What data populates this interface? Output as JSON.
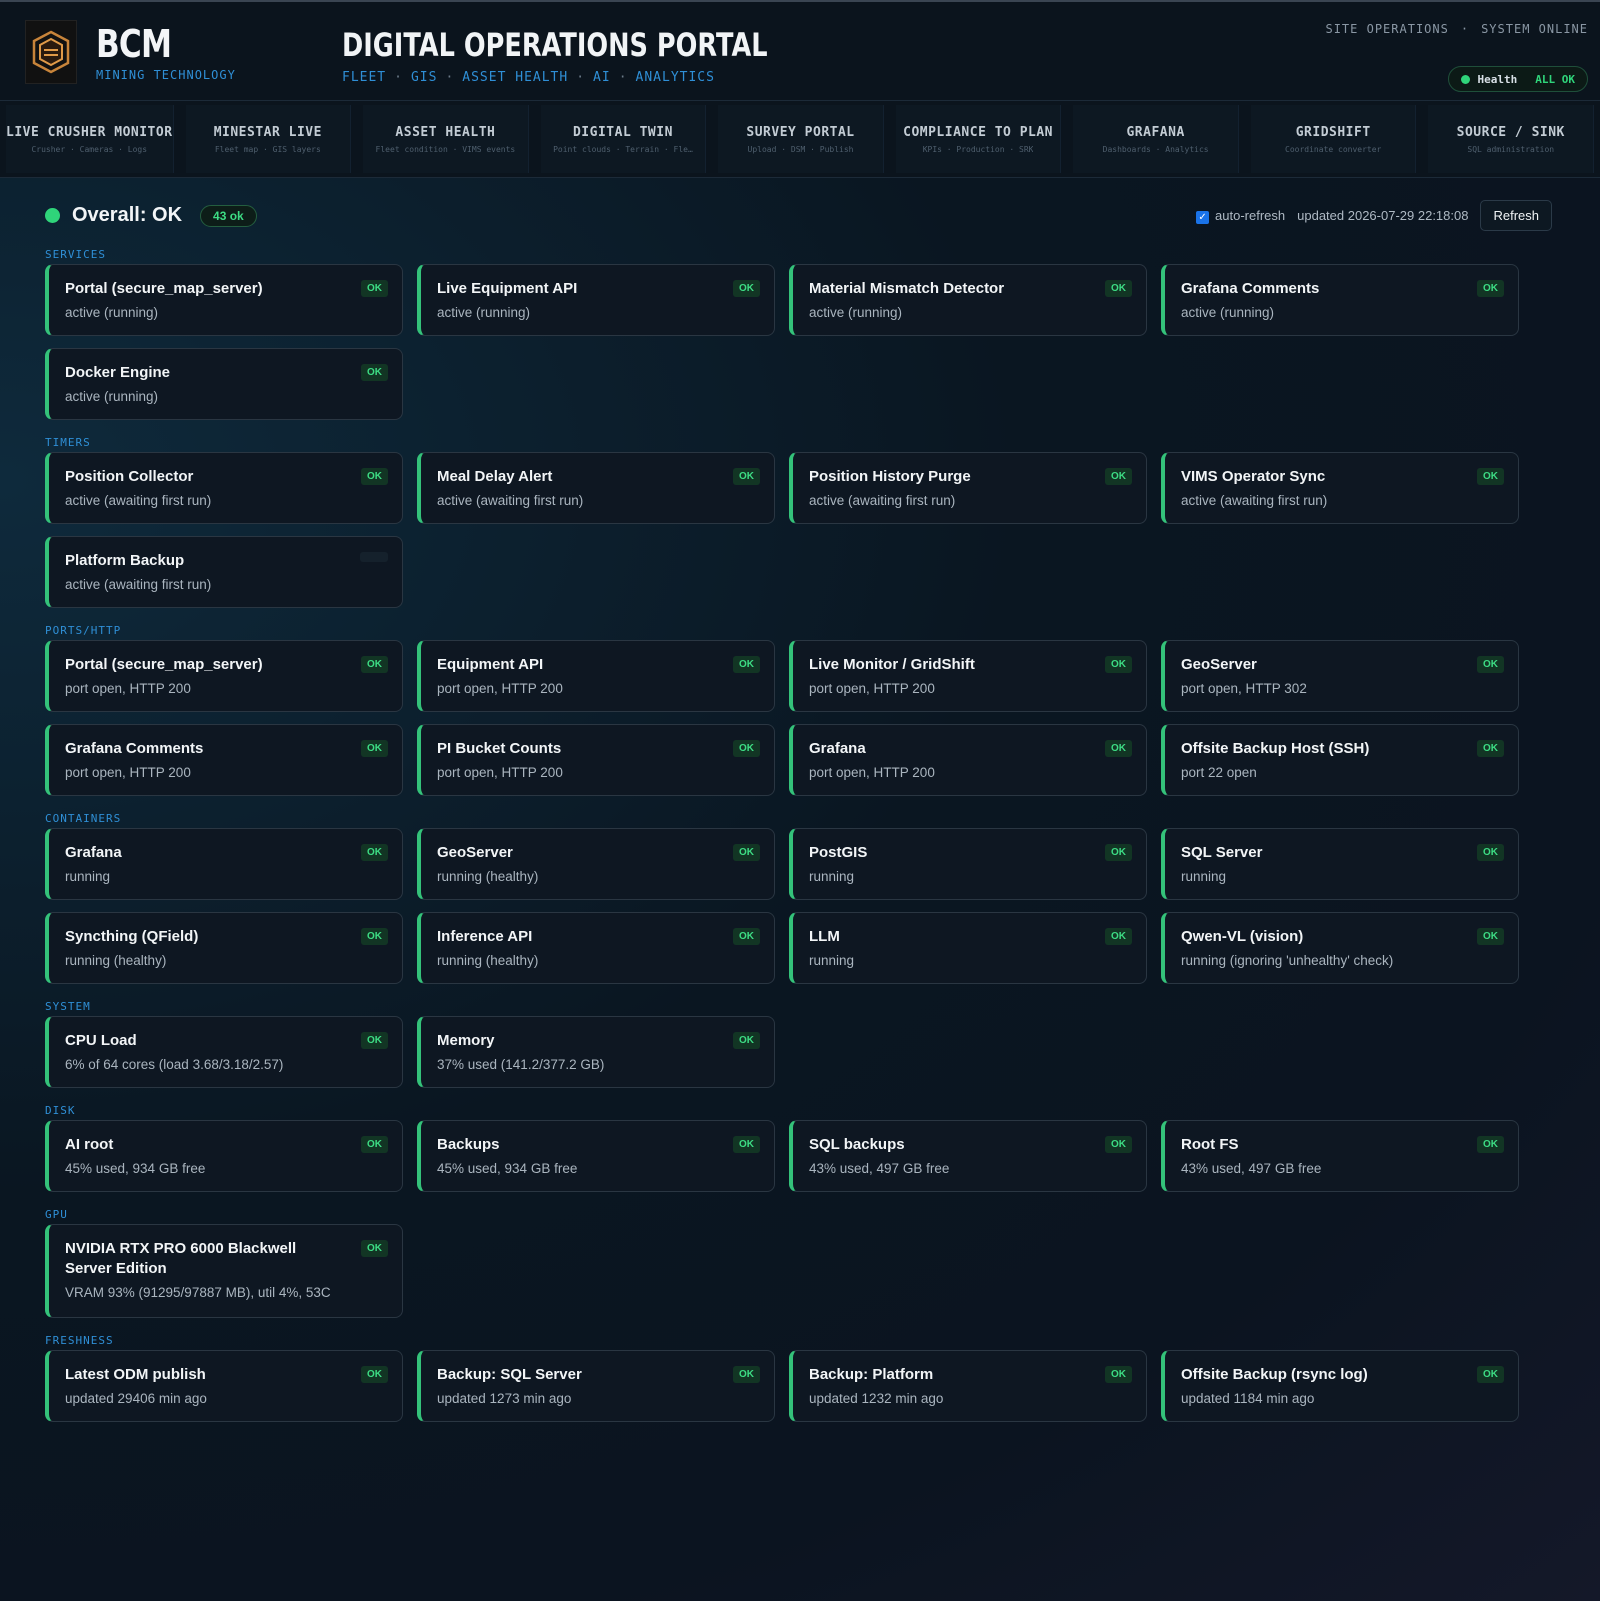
{
  "header": {
    "brand_name": "BCM",
    "brand_sub": "MINING TECHNOLOGY",
    "portal_title": "DIGITAL OPERATIONS PORTAL",
    "portal_tags": [
      "FLEET",
      "GIS",
      "ASSET HEALTH",
      "AI",
      "ANALYTICS"
    ],
    "site_ops": "SITE OPERATIONS",
    "system_online": "SYSTEM ONLINE",
    "health_label": "Health",
    "health_value": "ALL OK"
  },
  "nav": [
    {
      "title": "LIVE CRUSHER MONITOR",
      "sub": "Crusher · Cameras · Logs"
    },
    {
      "title": "MINESTAR LIVE",
      "sub": "Fleet map · GIS layers"
    },
    {
      "title": "ASSET HEALTH",
      "sub": "Fleet condition · VIMS events"
    },
    {
      "title": "DIGITAL TWIN",
      "sub": "Point clouds · Terrain · Fle…"
    },
    {
      "title": "SURVEY PORTAL",
      "sub": "Upload · DSM · Publish"
    },
    {
      "title": "COMPLIANCE TO PLAN",
      "sub": "KPIs · Production · SRK"
    },
    {
      "title": "GRAFANA",
      "sub": "Dashboards · Analytics"
    },
    {
      "title": "GRIDSHIFT",
      "sub": "Coordinate converter"
    },
    {
      "title": "SOURCE / SINK",
      "sub": "SQL administration"
    }
  ],
  "status": {
    "overall": "Overall: OK",
    "count": "43 ok",
    "auto_refresh": "auto-refresh",
    "updated": "updated 2026-07-29 22:18:08",
    "refresh_label": "Refresh"
  },
  "sections": [
    {
      "label": "SERVICES",
      "cards": [
        {
          "title": "Portal (secure_map_server)",
          "detail": "active (running)",
          "badge": "OK"
        },
        {
          "title": "Live Equipment API",
          "detail": "active (running)",
          "badge": "OK"
        },
        {
          "title": "Material Mismatch Detector",
          "detail": "active (running)",
          "badge": "OK"
        },
        {
          "title": "Grafana Comments",
          "detail": "active (running)",
          "badge": "OK"
        },
        {
          "title": "Docker Engine",
          "detail": "active (running)",
          "badge": "OK"
        }
      ]
    },
    {
      "label": "TIMERS",
      "cards": [
        {
          "title": "Position Collector",
          "detail": "active (awaiting first run)",
          "badge": "OK"
        },
        {
          "title": "Meal Delay Alert",
          "detail": "active (awaiting first run)",
          "badge": "OK"
        },
        {
          "title": "Position History Purge",
          "detail": "active (awaiting first run)",
          "badge": "OK"
        },
        {
          "title": "VIMS Operator Sync",
          "detail": "active (awaiting first run)",
          "badge": "OK"
        },
        {
          "title": "Platform Backup",
          "detail": "active (awaiting first run)",
          "badge": ""
        }
      ]
    },
    {
      "label": "PORTS/HTTP",
      "cards": [
        {
          "title": "Portal (secure_map_server)",
          "detail": "port open, HTTP 200",
          "badge": "OK"
        },
        {
          "title": "Equipment API",
          "detail": "port open, HTTP 200",
          "badge": "OK"
        },
        {
          "title": "Live Monitor / GridShift",
          "detail": "port open, HTTP 200",
          "badge": "OK"
        },
        {
          "title": "GeoServer",
          "detail": "port open, HTTP 302",
          "badge": "OK"
        },
        {
          "title": "Grafana Comments",
          "detail": "port open, HTTP 200",
          "badge": "OK"
        },
        {
          "title": "PI Bucket Counts",
          "detail": "port open, HTTP 200",
          "badge": "OK"
        },
        {
          "title": "Grafana",
          "detail": "port open, HTTP 200",
          "badge": "OK"
        },
        {
          "title": "Offsite Backup Host (SSH)",
          "detail": "port 22 open",
          "badge": "OK"
        }
      ]
    },
    {
      "label": "CONTAINERS",
      "cards": [
        {
          "title": "Grafana",
          "detail": "running",
          "badge": "OK"
        },
        {
          "title": "GeoServer",
          "detail": "running (healthy)",
          "badge": "OK"
        },
        {
          "title": "PostGIS",
          "detail": "running",
          "badge": "OK"
        },
        {
          "title": "SQL Server",
          "detail": "running",
          "badge": "OK"
        },
        {
          "title": "Syncthing (QField)",
          "detail": "running (healthy)",
          "badge": "OK"
        },
        {
          "title": "Inference API",
          "detail": "running (healthy)",
          "badge": "OK"
        },
        {
          "title": "LLM",
          "detail": "running",
          "badge": "OK"
        },
        {
          "title": "Qwen-VL (vision)",
          "detail": "running (ignoring 'unhealthy' check)",
          "badge": "OK"
        }
      ]
    },
    {
      "label": "SYSTEM",
      "cards": [
        {
          "title": "CPU Load",
          "detail": "6% of 64 cores (load 3.68/3.18/2.57)",
          "badge": "OK"
        },
        {
          "title": "Memory",
          "detail": "37% used (141.2/377.2 GB)",
          "badge": "OK"
        }
      ]
    },
    {
      "label": "DISK",
      "cards": [
        {
          "title": "AI root",
          "detail": "45% used, 934 GB free",
          "badge": "OK"
        },
        {
          "title": "Backups",
          "detail": "45% used, 934 GB free",
          "badge": "OK"
        },
        {
          "title": "SQL backups",
          "detail": "43% used, 497 GB free",
          "badge": "OK"
        },
        {
          "title": "Root FS",
          "detail": "43% used, 497 GB free",
          "badge": "OK"
        }
      ]
    },
    {
      "label": "GPU",
      "cards": [
        {
          "title": "NVIDIA RTX PRO 6000 Blackwell Server Edition",
          "detail": "VRAM 93% (91295/97887 MB), util 4%, 53C",
          "badge": "OK",
          "tall": true
        }
      ]
    },
    {
      "label": "FRESHNESS",
      "cards": [
        {
          "title": "Latest ODM publish",
          "detail": "updated 29406 min ago",
          "badge": "OK"
        },
        {
          "title": "Backup: SQL Server",
          "detail": "updated 1273 min ago",
          "badge": "OK"
        },
        {
          "title": "Backup: Platform",
          "detail": "updated 1232 min ago",
          "badge": "OK"
        },
        {
          "title": "Offsite Backup (rsync log)",
          "detail": "updated 1184 min ago",
          "badge": "OK"
        }
      ]
    }
  ],
  "colors": {
    "accent": "#34c27a",
    "section": "#2f8fd6",
    "ok": "#3ddc84"
  }
}
